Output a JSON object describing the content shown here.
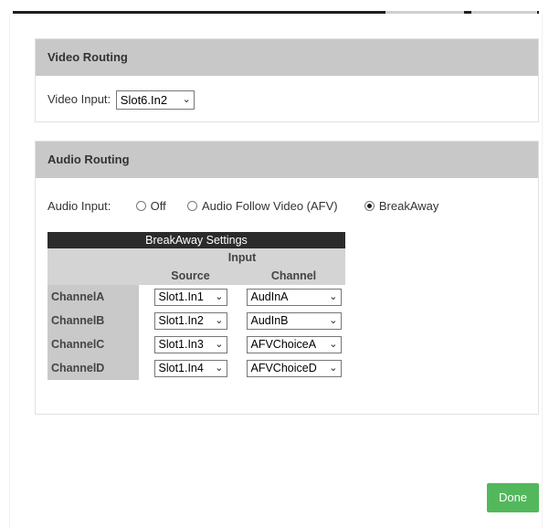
{
  "video_routing": {
    "title": "Video Routing",
    "input_label": "Video Input:",
    "input_value": "Slot6.In2"
  },
  "audio_routing": {
    "title": "Audio Routing",
    "input_label": "Audio Input:",
    "options": [
      "Off",
      "Audio Follow Video (AFV)",
      "BreakAway"
    ],
    "selected": "BreakAway"
  },
  "breakaway": {
    "title": "BreakAway Settings",
    "group_header": "Input",
    "col_source": "Source",
    "col_channel": "Channel",
    "rows": [
      {
        "label": "ChannelA",
        "source": "Slot1.In1",
        "channel": "AudInA"
      },
      {
        "label": "ChannelB",
        "source": "Slot1.In2",
        "channel": "AudInB"
      },
      {
        "label": "ChannelC",
        "source": "Slot1.In3",
        "channel": "AFVChoiceA"
      },
      {
        "label": "ChannelD",
        "source": "Slot1.In4",
        "channel": "AFVChoiceD"
      }
    ]
  },
  "footer": {
    "done_label": "Done",
    "done_color": "#53b85b"
  },
  "icons": {
    "dropdown": "chevron-down-icon",
    "radio": "radio-icon"
  }
}
